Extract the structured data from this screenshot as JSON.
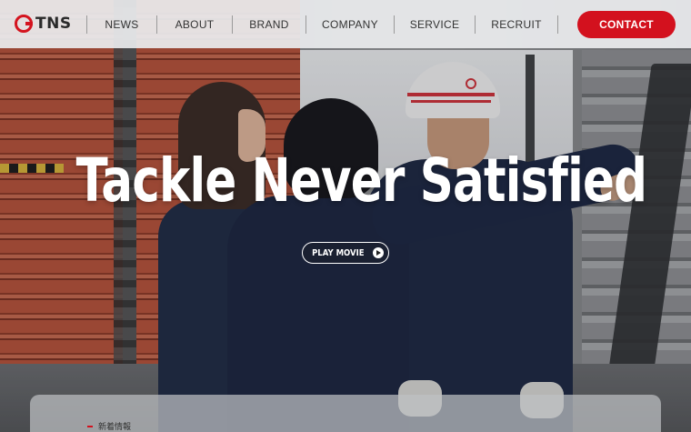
{
  "header": {
    "logo_text": "TNS",
    "nav": [
      "NEWS",
      "ABOUT",
      "BRAND",
      "COMPANY",
      "SERVICE",
      "RECRUIT"
    ],
    "contact_label": "CONTACT"
  },
  "hero": {
    "headline": "Tackle Never Satisfied",
    "play_label": "PLAY MOVIE"
  },
  "news": {
    "label": "新着情報"
  },
  "colors": {
    "accent": "#d3111e",
    "header_bg": "#ebecee",
    "headline": "#ffffff"
  },
  "icons": {
    "logo": "tns-logo-icon",
    "play": "play-circle-icon"
  }
}
